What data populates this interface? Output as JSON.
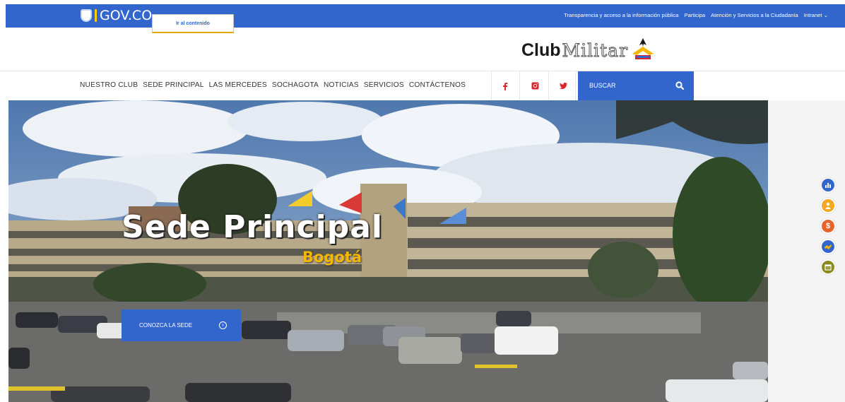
{
  "gov_bar": {
    "logo_text": "GOV.CO",
    "skip_link": "Ir al contenido",
    "links": [
      "Transparencia y acceso a la información pública",
      "Participa",
      "Atención y Servicios a la Ciudadanía",
      "Intranet ⌄"
    ]
  },
  "header": {
    "logo_club": "Club",
    "logo_militar": "Militar"
  },
  "nav": {
    "items": [
      "NUESTRO CLUB",
      "SEDE PRINCIPAL",
      "LAS MERCEDES",
      "SOCHAGOTA",
      "NOTICIAS",
      "SERVICIOS",
      "CONTÁCTENOS"
    ],
    "social": [
      "facebook-icon",
      "instagram-icon",
      "twitter-icon"
    ],
    "search_label": "BUSCAR"
  },
  "hero": {
    "title": "Sede Principal",
    "subtitle": "Bogotá",
    "cta_label": "CONOZCA LA SEDE"
  },
  "floating_icons": [
    {
      "name": "chart-icon",
      "color": "#3366cc"
    },
    {
      "name": "user-icon",
      "color": "#f5a623"
    },
    {
      "name": "dollar-icon",
      "color": "#e8632b"
    },
    {
      "name": "handshake-icon",
      "color": "#3366cc"
    },
    {
      "name": "calendar-icon",
      "color": "#8a8a1f"
    }
  ],
  "colors": {
    "accent": "#3366cc",
    "social_red": "#d9262c",
    "gold": "#f5b700"
  }
}
